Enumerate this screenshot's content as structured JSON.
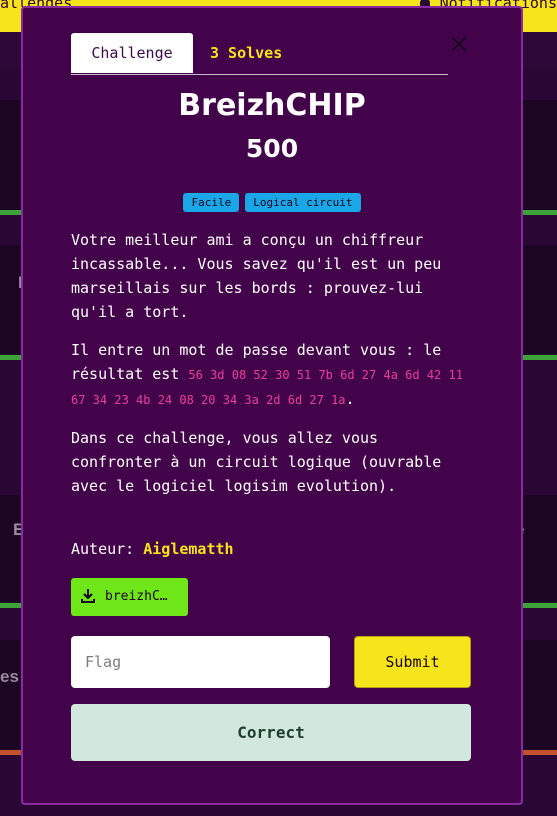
{
  "background": {
    "nav_left": "allenges",
    "nav_right": "Notifications",
    "side_letters": {
      "row1_left": "I",
      "row2_left": "E",
      "row2_right": "e",
      "row3_left": "es"
    }
  },
  "modal": {
    "tabs": [
      {
        "label": "Challenge",
        "active": true
      },
      {
        "label": "3 Solves",
        "active": false
      }
    ],
    "title": "BreizhCHIP",
    "value": "500",
    "tags": [
      "Facile",
      "Logical circuit"
    ],
    "description": {
      "p1": "Votre meilleur ami a conçu un chiffreur incassable... Vous savez qu'il est un peu marseillais sur les bords : prouvez-lui qu'il a tort.",
      "p2_prefix": "Il entre un mot de passe devant vous : le résultat est ",
      "p2_hex": "56 3d 08 52 30 51 7b 6d 27 4a 6d 42 11 67 34 23 4b 24 08 20 34 3a 2d 6d 27 1a",
      "p2_suffix": ".",
      "p3": "Dans ce challenge, vous allez vous confronter à un circuit logique (ouvrable avec le logiciel logisim evolution)."
    },
    "author_label": "Auteur: ",
    "author_name": "Aiglematth",
    "file_label": "breizhC…",
    "flag_placeholder": "Flag",
    "submit_label": "Submit",
    "result_label": "Correct"
  },
  "colors": {
    "modal_bg": "#43034a",
    "accent_yellow": "#f7e51b",
    "tag_blue": "#1aa7e8",
    "file_green": "#6ee617",
    "hex_pink": "#e8409a",
    "correct_bg": "#d2e7de"
  }
}
